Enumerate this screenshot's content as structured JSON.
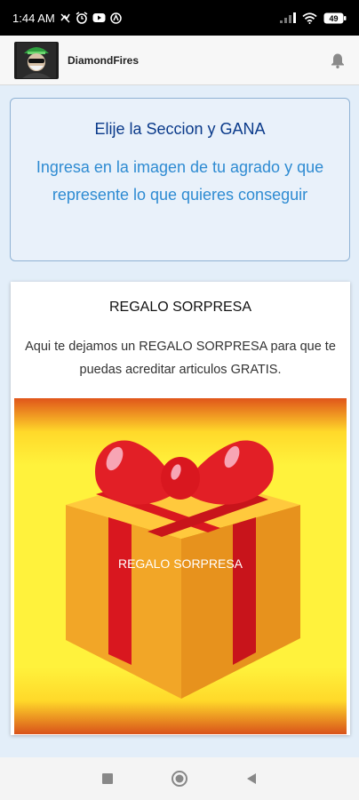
{
  "status_bar": {
    "time": "1:44 AM",
    "left_icons": [
      "sync-icon",
      "alarm-icon",
      "youtube-icon",
      "vpn-icon"
    ],
    "right_icons": [
      "signal-icon",
      "wifi-icon",
      "battery-icon"
    ],
    "battery_level": "49"
  },
  "app_bar": {
    "user_name": "DiamondFires",
    "avatar_icon": "avatar-icon",
    "bell_icon": "bell-icon"
  },
  "info_card": {
    "title": "Elije la Seccion y GANA",
    "subtitle": "Ingresa en la imagen de tu agrado y que represente lo que quieres conseguir"
  },
  "gift_card": {
    "title": "REGALO SORPRESA",
    "description": "Aqui te dejamos un REGALO SORPRESA para que te puedas acreditar articulos GRATIS.",
    "image_label": "REGALO SORPRESA"
  },
  "nav_bar": {
    "icons": [
      "recents-icon",
      "home-icon",
      "back-icon"
    ]
  },
  "colors": {
    "info_title": "#0a3a8a",
    "info_text": "#2e8bd2",
    "gift_background": "#ffef3c",
    "ribbon": "#d9171f",
    "box": "#f4a623"
  }
}
